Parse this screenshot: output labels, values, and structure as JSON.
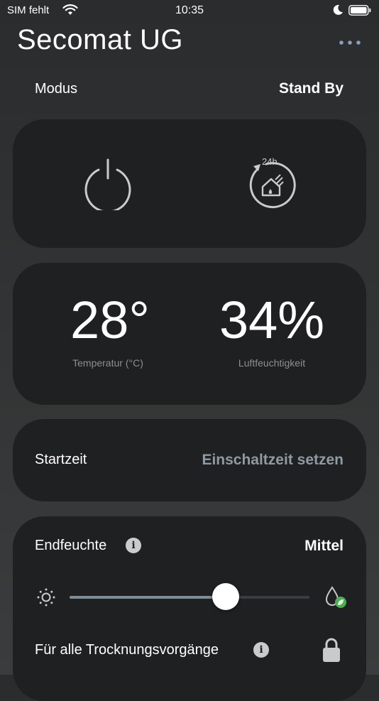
{
  "status_bar": {
    "carrier": "SIM fehlt",
    "time": "10:35"
  },
  "header": {
    "title": "Secomat UG",
    "menu_icon": "more-dots-icon"
  },
  "mode": {
    "label": "Modus",
    "value": "Stand By"
  },
  "mode_buttons": [
    {
      "icon": "power-icon"
    },
    {
      "icon": "timer-24h-house-icon",
      "badge": "24h"
    }
  ],
  "climate": {
    "temperature": {
      "value": "28°",
      "caption": "Temperatur (°C)"
    },
    "humidity": {
      "value": "34%",
      "caption": "Luftfeuchtigkeit"
    }
  },
  "start_time": {
    "label": "Startzeit",
    "action": "Einschaltzeit setzen"
  },
  "end_humidity": {
    "label": "Endfeuchte",
    "value": "Mittel",
    "slider_level": 0.65,
    "min_icon": "sun-icon",
    "max_icon": "droplet-leaf-icon",
    "apply_all_label": "Für alle Trocknungsvorgänge",
    "lock_icon": "lock-icon"
  },
  "colors": {
    "card": "#1e2021",
    "accent_green": "#4caf50",
    "link": "#8f9aa3"
  }
}
